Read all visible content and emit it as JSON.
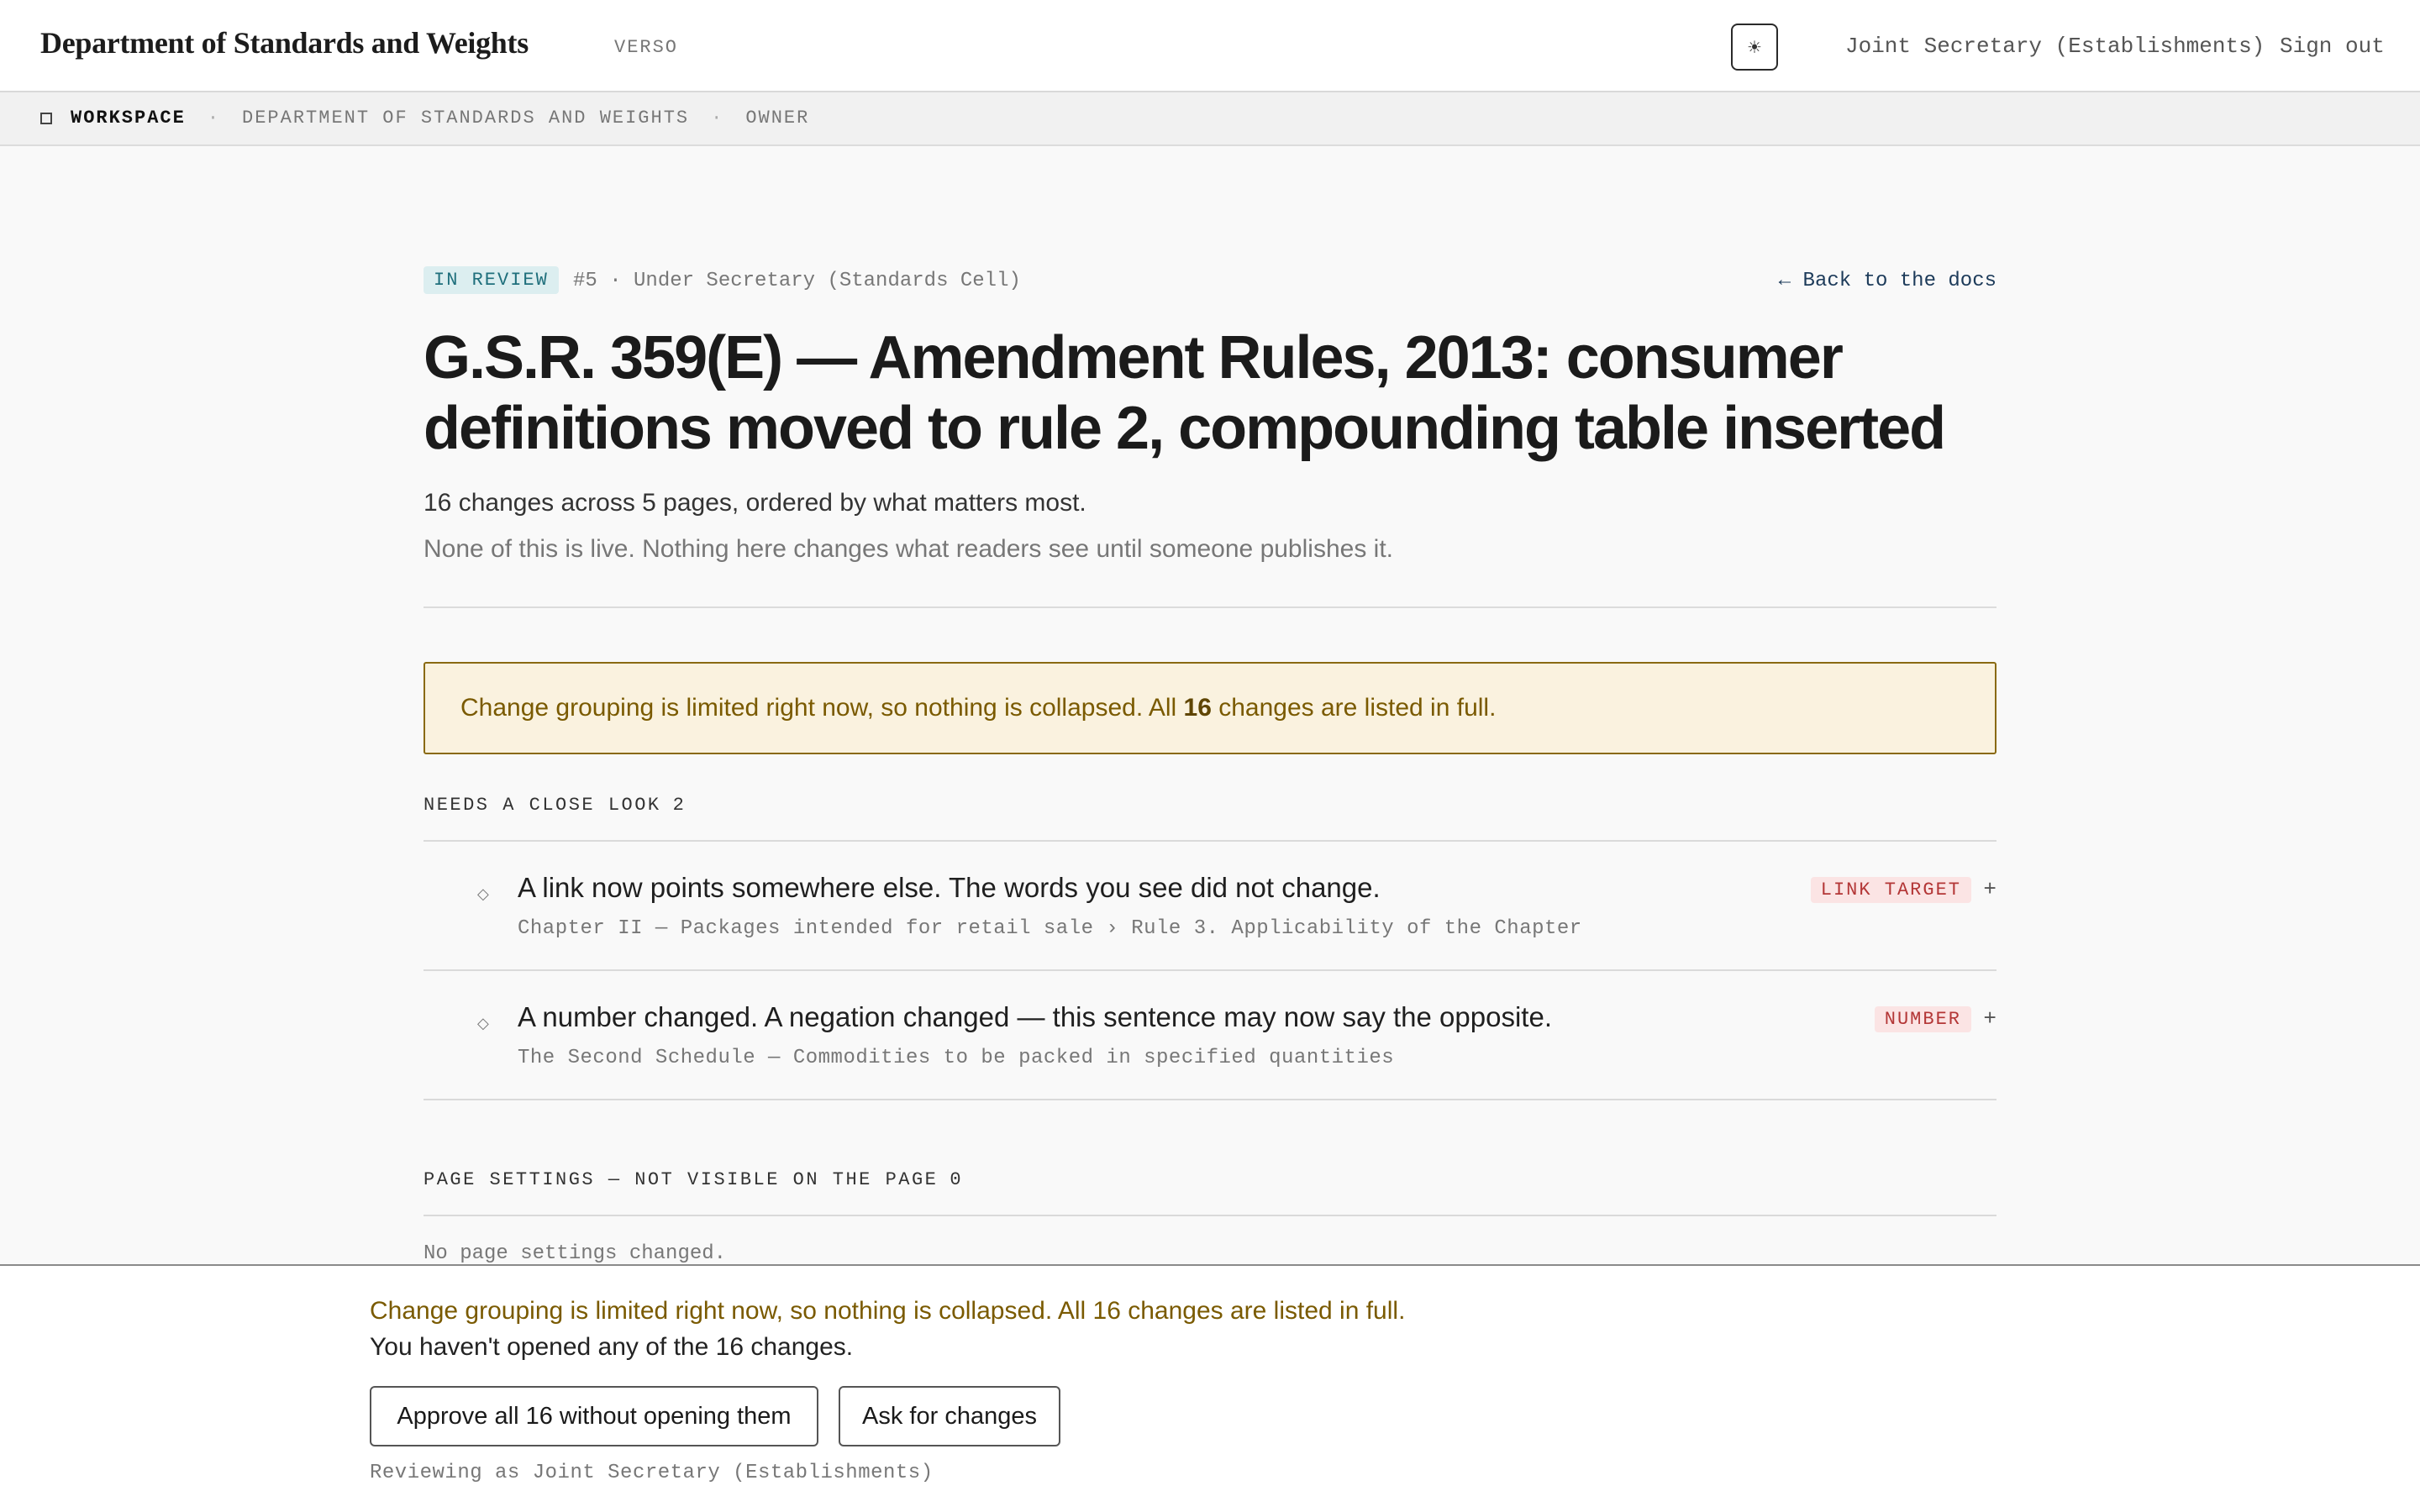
{
  "header": {
    "brand": "Department of Standards and Weights",
    "brand_sub": "VERSO",
    "theme_toggle_icon": "☀",
    "user": "Joint Secretary (Establishments)",
    "sign_out": "Sign out"
  },
  "breadcrumb": {
    "items": [
      "WORKSPACE",
      "DEPARTMENT OF STANDARDS AND WEIGHTS",
      "OWNER"
    ],
    "separator": "·"
  },
  "review": {
    "status": "IN REVIEW",
    "meta": "#5 · Under Secretary (Standards Cell)",
    "back_link": "← Back to the docs",
    "title": "G.S.R. 359(E) — Amendment Rules, 2013: consumer definitions moved to rule 2, compounding table inserted",
    "summary": "16 changes across 5 pages, ordered by what matters most.",
    "note": "None of this is live. Nothing here changes what readers see until someone publishes it."
  },
  "banner": {
    "text_before": "Change grouping is limited right now, so nothing is collapsed. All ",
    "count": "16",
    "text_after": " changes are listed in full."
  },
  "sections": {
    "close_look": {
      "heading": "NEEDS A CLOSE LOOK",
      "count": "2",
      "items": [
        {
          "icon": "◇",
          "title": "A link now points somewhere else. The words you see did not change.",
          "path": "Chapter II — Packages intended for retail sale › Rule 3. Applicability of the Chapter",
          "tag": "LINK TARGET",
          "expand": "+"
        },
        {
          "icon": "◇",
          "title": "A number changed. A negation changed — this sentence may now say the opposite.",
          "path": "The Second Schedule — Commodities to be packed in specified quantities",
          "tag": "NUMBER",
          "expand": "+"
        }
      ]
    },
    "page_settings": {
      "heading": "PAGE SETTINGS — NOT VISIBLE ON THE PAGE",
      "count": "0",
      "empty": "No page settings changed."
    }
  },
  "action_bar": {
    "warning": "Change grouping is limited right now, so nothing is collapsed. All 16 changes are listed in full.",
    "status": "You haven't opened any of the 16 changes.",
    "approve_label": "Approve all 16 without opening them",
    "request_label": "Ask for changes",
    "reviewer": "Reviewing as Joint Secretary (Establishments)"
  },
  "colors": {
    "badge_bg": "#dceef0",
    "badge_text": "#1f6f7c",
    "warning_bg": "#faf2df",
    "warning_border": "#8a6a12",
    "warning_text": "#7a5a00",
    "tag_bg": "#fbe4e4",
    "tag_text": "#b33636"
  }
}
